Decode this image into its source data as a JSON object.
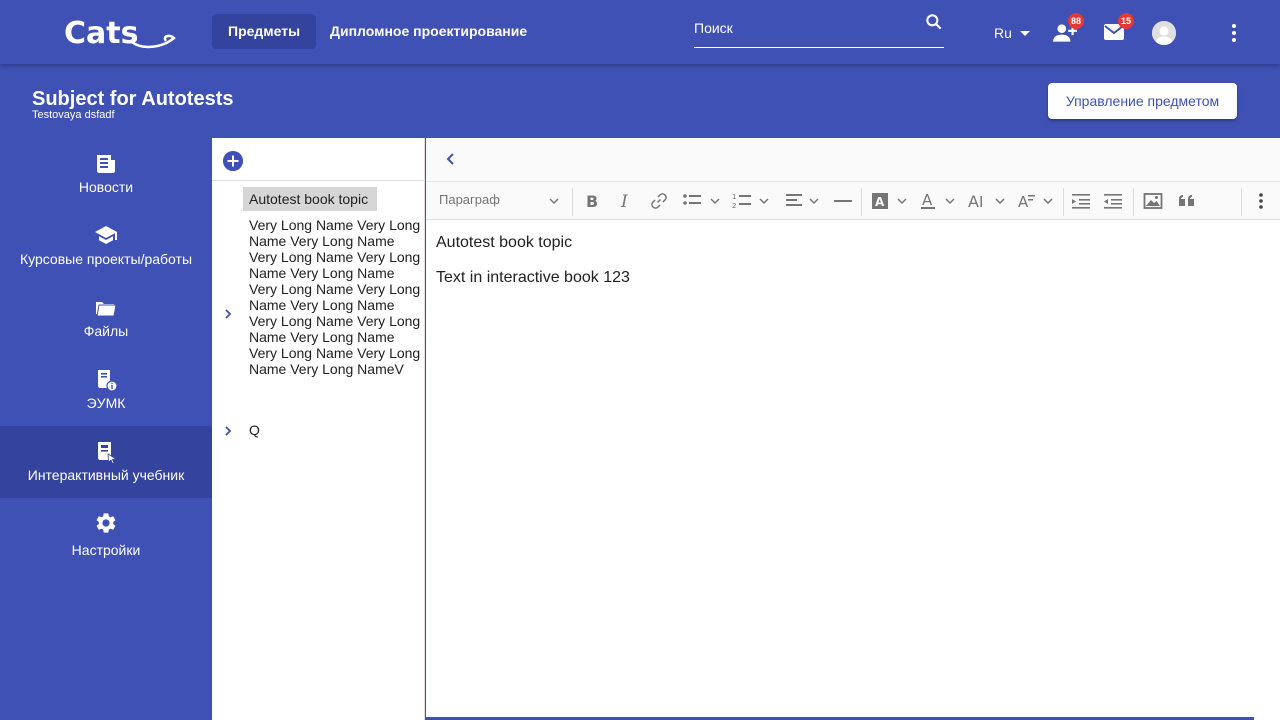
{
  "header": {
    "logo_text": "Cats",
    "nav": [
      {
        "label": "Предметы",
        "active": true
      },
      {
        "label": "Дипломное проектирование",
        "active": false
      }
    ],
    "search_placeholder": "Поиск",
    "language": "Ru",
    "notifications": {
      "groups_badge": "88",
      "messages_badge": "15"
    }
  },
  "subject": {
    "title": "Subject for Autotests",
    "subtitle": "Testovaya dsfadf",
    "manage_label": "Управление предметом"
  },
  "sidebar": {
    "items": [
      {
        "label": "Новости",
        "icon": "news-icon"
      },
      {
        "label": "Курсовые проекты/работы",
        "icon": "school-icon"
      },
      {
        "label": "Файлы",
        "icon": "folder-icon"
      },
      {
        "label": "ЭУМК",
        "icon": "book-info-icon"
      },
      {
        "label": "Интерактивный учебник",
        "icon": "interactive-book-icon",
        "active": true
      },
      {
        "label": "Настройки",
        "icon": "gear-icon"
      }
    ]
  },
  "topics": {
    "items": [
      {
        "label": "Autotest book topic",
        "selected": true,
        "has_children": false
      },
      {
        "label": "Very Long Name Very Long Name Very Long Name Very Long Name Very Long Name Very Long Name Very Long Name Very Long Name Very Long Name Very Long Name Very Long Name Very Long Name Very Long Name Very Long Name Very Long NameV",
        "selected": false,
        "has_children": true
      },
      {
        "label": "Q",
        "selected": false,
        "has_children": true
      }
    ]
  },
  "editor": {
    "paragraph_style": "Параграф",
    "content": [
      "Autotest book topic",
      "Text in interactive book 123"
    ]
  },
  "colors": {
    "primary": "#3f51b5",
    "primary_dark": "#34449e",
    "badge": "#e53935"
  }
}
